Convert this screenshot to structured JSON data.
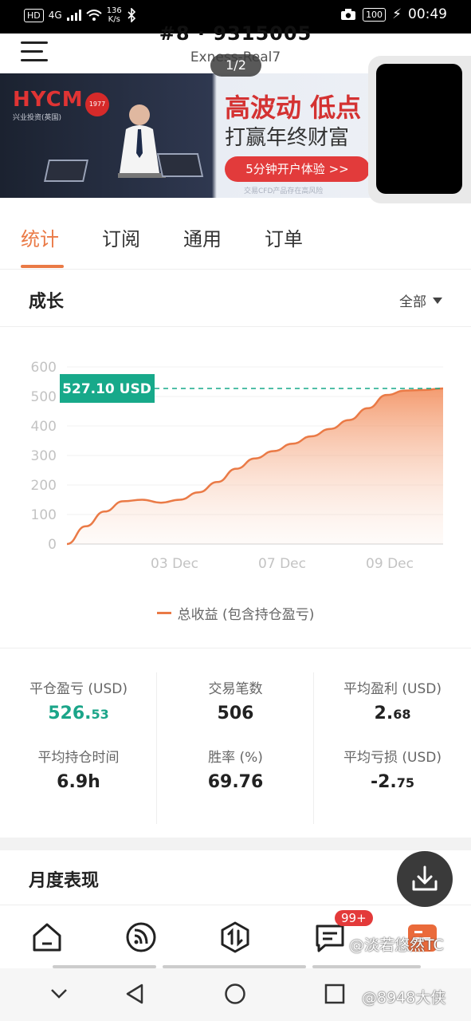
{
  "status_bar": {
    "network": "4G",
    "speed_value": "136",
    "speed_unit": "K/s",
    "battery": "100",
    "time": "00:49"
  },
  "header": {
    "title": "#8 · 9315005",
    "subtitle": "Exness-Real7",
    "page_indicator": "1/2"
  },
  "banner": {
    "logo": "HYCM",
    "logo_sub": "兴业投资(英国)",
    "badge": "1977",
    "headline": "高波动 低点",
    "subheadline": "打赢年终财富",
    "cta": "5分钟开户体验 >>",
    "note": "交易CFD产品存在高风险"
  },
  "tabs": [
    {
      "label": "统计",
      "active": true
    },
    {
      "label": "订阅",
      "active": false
    },
    {
      "label": "通用",
      "active": false
    },
    {
      "label": "订单",
      "active": false
    }
  ],
  "growth": {
    "title": "成长",
    "filter": "全部"
  },
  "chart_data": {
    "type": "area",
    "color": "#ea7a46",
    "y_ticks": [
      "600",
      "500",
      "400",
      "300",
      "200",
      "100",
      "0"
    ],
    "ylim": [
      0,
      600
    ],
    "x_ticks": [
      "03 Dec",
      "07 Dec",
      "09 Dec"
    ],
    "series": [
      {
        "name": "总收益 (包含持仓盈亏)",
        "values": [
          0,
          60,
          110,
          145,
          150,
          140,
          150,
          175,
          210,
          255,
          290,
          315,
          340,
          365,
          390,
          420,
          460,
          505,
          520,
          522,
          527.1
        ]
      }
    ],
    "current_label": "527.10 USD",
    "current_value": 527.1,
    "label_color": "#17a98a"
  },
  "stats": [
    {
      "label": "平仓盈亏 (USD)",
      "value_main": "526.",
      "value_small": "53",
      "highlight": true
    },
    {
      "label": "交易笔数",
      "value_main": "506",
      "value_small": "",
      "highlight": false
    },
    {
      "label": "平均盈利 (USD)",
      "value_main": "2.",
      "value_small": "68",
      "highlight": false
    },
    {
      "label": "平均持仓时间",
      "value_main": "6.9h",
      "value_small": "",
      "highlight": false
    },
    {
      "label": "胜率 (%)",
      "value_main": "69.76",
      "value_small": "",
      "highlight": false
    },
    {
      "label": "平均亏损 (USD)",
      "value_main": "-2.",
      "value_small": "75",
      "highlight": false
    }
  ],
  "monthly": {
    "title": "月度表现"
  },
  "bottom_nav": {
    "icons": [
      "home-icon",
      "feed-icon",
      "trade-icon",
      "message-icon",
      "profile-icon"
    ],
    "badge": "99+"
  },
  "watermarks": [
    "@淡若悠然TC",
    "@8948大侠"
  ]
}
